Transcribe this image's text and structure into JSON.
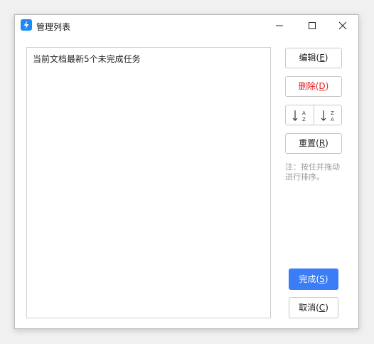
{
  "window": {
    "title": "管理列表"
  },
  "list": {
    "items": [
      "当前文档最新5个未完成任务"
    ]
  },
  "buttons": {
    "edit": {
      "label": "编辑(",
      "key": "E",
      "suffix": ")"
    },
    "delete": {
      "label": "删除(",
      "key": "D",
      "suffix": ")"
    },
    "reset": {
      "label": "重置(",
      "key": "R",
      "suffix": ")"
    },
    "done": {
      "label": "完成(",
      "key": "S",
      "suffix": ")"
    },
    "cancel": {
      "label": "取消(",
      "key": "C",
      "suffix": ")"
    }
  },
  "sort": {
    "asc_icon": "sort-ascending-icon",
    "desc_icon": "sort-descending-icon",
    "top_letter_asc": "A",
    "bottom_letter_asc": "Z",
    "top_letter_desc": "Z",
    "bottom_letter_desc": "A"
  },
  "note": {
    "text": "注：按住并拖动进行排序。"
  },
  "colors": {
    "accent": "#3b7cf7",
    "danger": "#e02020",
    "app_icon": "#1e88f5"
  }
}
